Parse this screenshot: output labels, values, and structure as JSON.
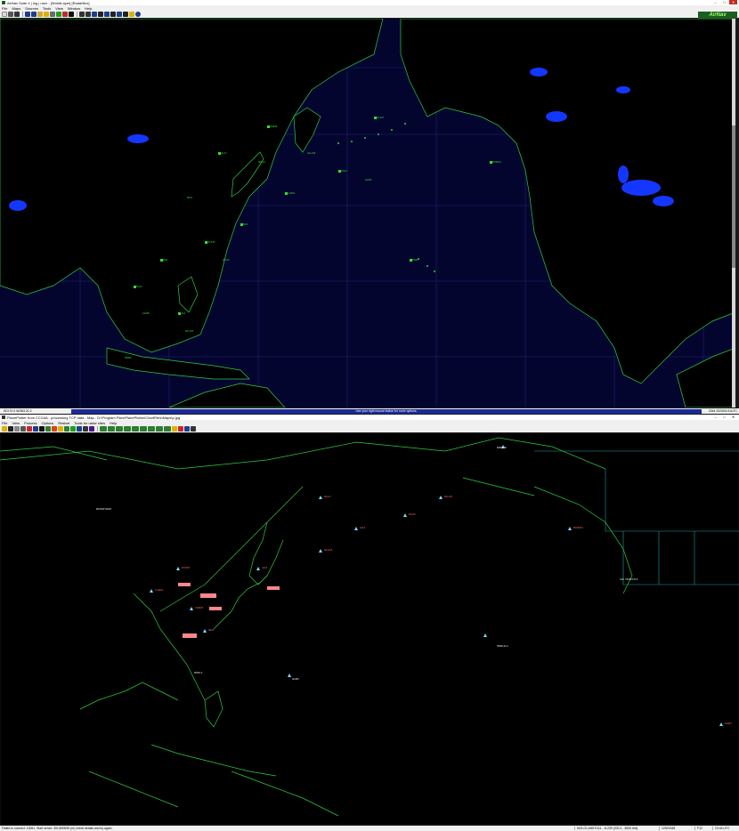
{
  "top_window": {
    "title": "AirNav Suite 4 | log | user - [WorldLayer] [RadarBox]",
    "menu": [
      "File",
      "Maps",
      "Sources",
      "Tools",
      "View",
      "Window",
      "Help"
    ],
    "logo_text": "AirNav",
    "status_left": "SDI 37.0 W/363.21.0",
    "status_hint": "Use your right mouse button for more options.",
    "status_time": "2344 2023/01/11UTC"
  },
  "bottom_window": {
    "title": "PlanePlotter from CCXAA - processing TCP data - Map - D:\\Program Files\\PlanePlotter\\ChartFiles\\Maps\\p.jpg",
    "menu": [
      "File",
      "View",
      "Process",
      "Options",
      "Restart",
      "Tools for radar sites",
      "Help"
    ],
    "status_left": "Failed to connect: 10061. Start server: 30L5698/50 (m) check details and try again.",
    "status_cells": [
      "N23-G1-N69 E111 - N.209 (200.3 - 3830.4mi)",
      "129/0/168",
      "F12",
      "23:44 UTC"
    ]
  },
  "map_labels_top": [
    {
      "t": "UAL27",
      "c": "g"
    },
    {
      "t": "CPA880",
      "c": "g"
    },
    {
      "t": "JAL8",
      "c": "g"
    },
    {
      "t": "KAL035",
      "c": "g"
    },
    {
      "t": "ANA6",
      "c": "g"
    },
    {
      "t": "EVA15",
      "c": "g"
    },
    {
      "t": "CAL5",
      "c": "g"
    },
    {
      "t": "DAL167",
      "c": "g"
    },
    {
      "t": "FDX9051",
      "c": "g"
    },
    {
      "t": "UPS82",
      "c": "g"
    },
    {
      "t": "SIA12",
      "c": "g"
    },
    {
      "t": "CCA981",
      "c": "g"
    },
    {
      "t": "HVN50",
      "c": "g"
    },
    {
      "t": "MAS1",
      "c": "g"
    },
    {
      "t": "GIA88",
      "c": "g"
    },
    {
      "t": "PAL101",
      "c": "g"
    },
    {
      "t": "AAL169",
      "c": "g"
    },
    {
      "t": "ASA87",
      "c": "g"
    },
    {
      "t": "HAL24",
      "c": "g"
    },
    {
      "t": "QFA15",
      "c": "g"
    }
  ],
  "map_labels_bottom": [
    {
      "t": "BANGKOK",
      "c": "wt"
    },
    {
      "t": "KRASNOYARSK",
      "c": "wt"
    },
    {
      "t": "SAN FRANCISCO",
      "c": "wt"
    },
    {
      "t": "HONOLULU",
      "c": "wt"
    },
    {
      "t": "AGANA",
      "c": "wt"
    },
    {
      "t": "MANILA",
      "c": "wt"
    },
    {
      "t": "CCA981",
      "c": "pk"
    },
    {
      "t": "CES587",
      "c": "pk"
    },
    {
      "t": "CSN303",
      "c": "pk"
    },
    {
      "t": "JAL8",
      "c": "pk"
    },
    {
      "t": "KAL035",
      "c": "pk"
    },
    {
      "t": "ANA6",
      "c": "pk"
    },
    {
      "t": "EVA15",
      "c": "pk"
    },
    {
      "t": "CAL5",
      "c": "pk"
    },
    {
      "t": "UAL27",
      "c": "pk"
    },
    {
      "t": "DAL167",
      "c": "pk"
    },
    {
      "t": "FDX9051",
      "c": "pk"
    },
    {
      "t": "ASA87",
      "c": "pk"
    }
  ]
}
